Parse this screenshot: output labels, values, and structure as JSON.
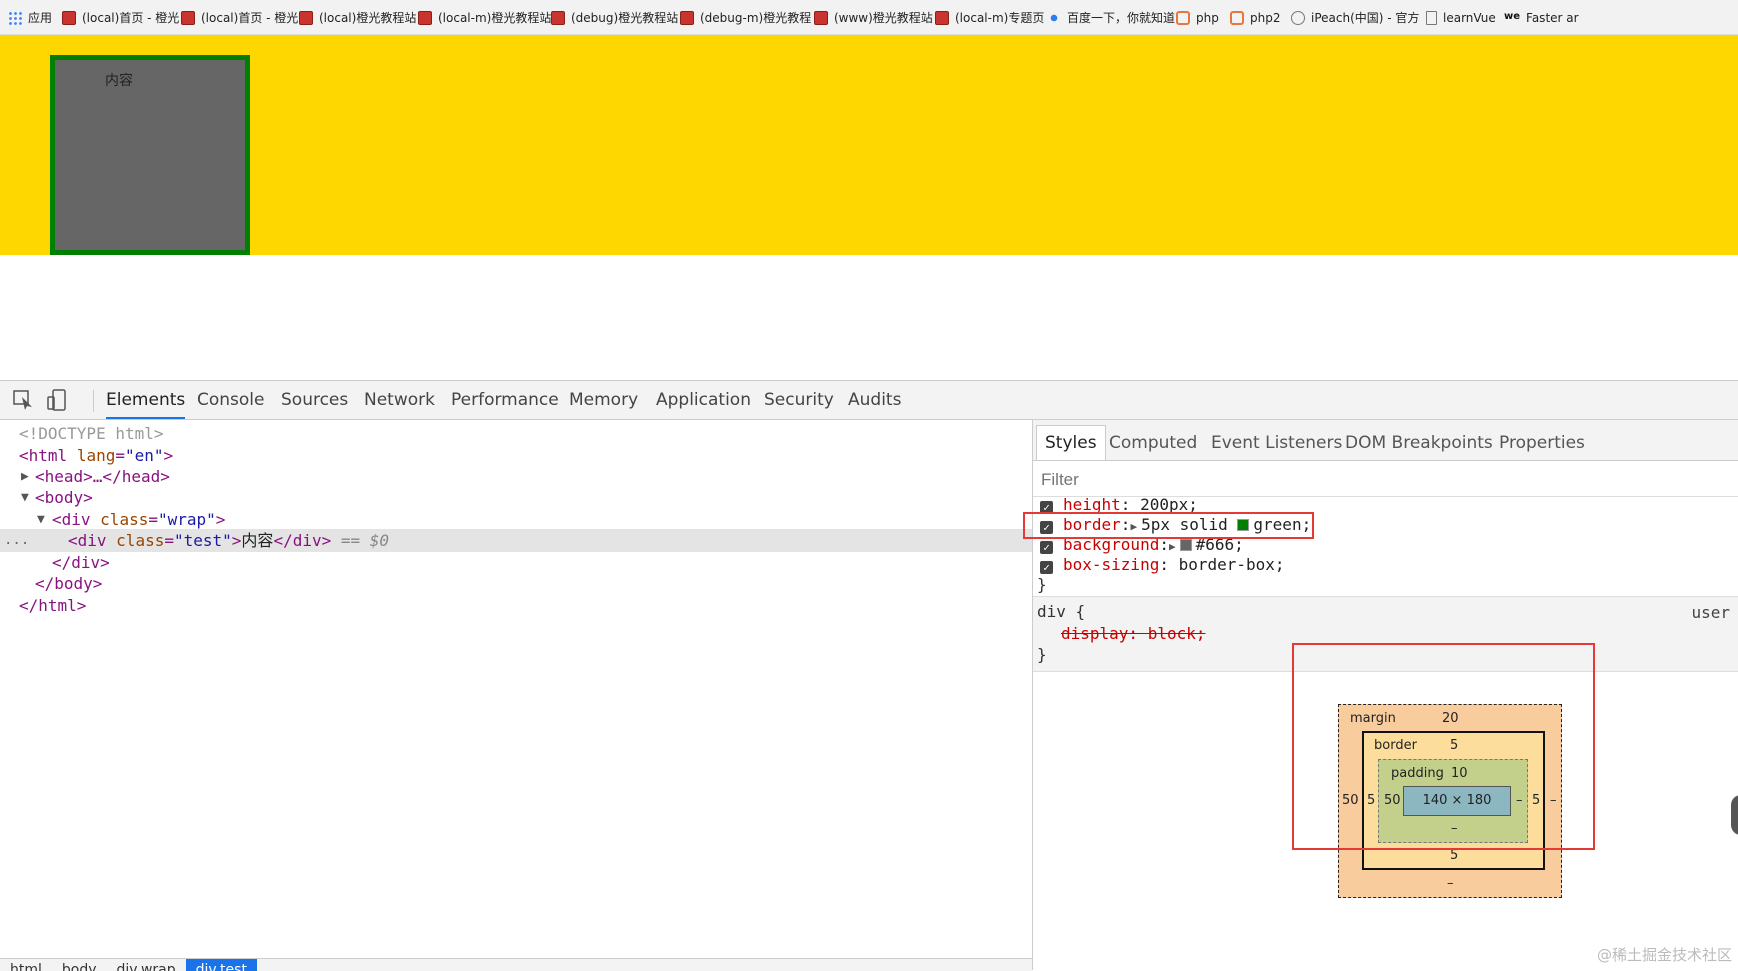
{
  "bookmarks": [
    {
      "icon": "apps-icon",
      "label": "应用"
    },
    {
      "icon": "site-icon",
      "label": "(local)首页 - 橙光"
    },
    {
      "icon": "site-icon",
      "label": "(local)首页 - 橙光"
    },
    {
      "icon": "site-icon",
      "label": "(local)橙光教程站"
    },
    {
      "icon": "site-icon",
      "label": "(local-m)橙光教程站"
    },
    {
      "icon": "site-icon",
      "label": "(debug)橙光教程站"
    },
    {
      "icon": "site-icon",
      "label": "(debug-m)橙光教程"
    },
    {
      "icon": "site-icon",
      "label": "(www)橙光教程站"
    },
    {
      "icon": "site-icon",
      "label": "(local-m)专题页"
    },
    {
      "icon": "baidu-icon",
      "label": "百度一下，你就知道"
    },
    {
      "icon": "php-icon",
      "label": "php"
    },
    {
      "icon": "php-icon",
      "label": "php2"
    },
    {
      "icon": "ipeach-icon",
      "label": "iPeach(中国) - 官方"
    },
    {
      "icon": "doc-icon",
      "label": "learnVue"
    },
    {
      "icon": "we-icon",
      "label": "Faster ar"
    }
  ],
  "page": {
    "test_content": "内容"
  },
  "devtools": {
    "tabs": [
      "Elements",
      "Console",
      "Sources",
      "Network",
      "Performance",
      "Memory",
      "Application",
      "Security",
      "Audits"
    ],
    "active_tab": "Elements",
    "dom": {
      "doctype": "<!DOCTYPE html>",
      "html_open_tag": "<html",
      "html_attr": "lang",
      "html_attr_val": "\"en\"",
      "head_collapsed": "<head>…</head>",
      "body_open": "<body>",
      "wrap_tag": "<div",
      "wrap_attr": "class",
      "wrap_val": "\"wrap\"",
      "test_tag": "<div",
      "test_attr": "class",
      "test_val": "\"test\"",
      "test_text": "内容",
      "test_close": "</div>",
      "selected_marker": "== $0",
      "div_close": "</div>",
      "body_close": "</body>",
      "html_close": "</html>",
      "ellipsis": "..."
    },
    "breadcrumbs": [
      "html",
      "body",
      "div.wrap",
      "div.test"
    ],
    "styles": {
      "tabs": [
        "Styles",
        "Computed",
        "Event Listeners",
        "DOM Breakpoints",
        "Properties"
      ],
      "active_tab": "Styles",
      "filter_placeholder": "Filter",
      "props": [
        {
          "name": "height",
          "value": "200px;"
        },
        {
          "name": "border",
          "value": "5px solid",
          "swatch_color": "#008000",
          "value2": "green;"
        },
        {
          "name": "background",
          "swatch_color": "#666666",
          "value": "#666;"
        },
        {
          "name": "box-sizing",
          "value": "border-box;"
        }
      ],
      "close_brace": "}",
      "ua_rule": {
        "selector": "div {",
        "origin": "user",
        "prop": "display: block;",
        "close": "}"
      }
    },
    "box_model": {
      "margin_label": "margin",
      "margin_top": "20",
      "margin_left": "50",
      "margin_right": "–",
      "margin_bottom": "–",
      "border_label": "border",
      "border_top": "5",
      "border_left": "5",
      "border_right": "5",
      "border_bottom": "5",
      "padding_label": "padding",
      "padding_top": "10",
      "padding_left": "50",
      "padding_right": "–",
      "padding_bottom": "–",
      "content": "140 × 180"
    }
  },
  "watermark": "@稀土掘金技术社区"
}
